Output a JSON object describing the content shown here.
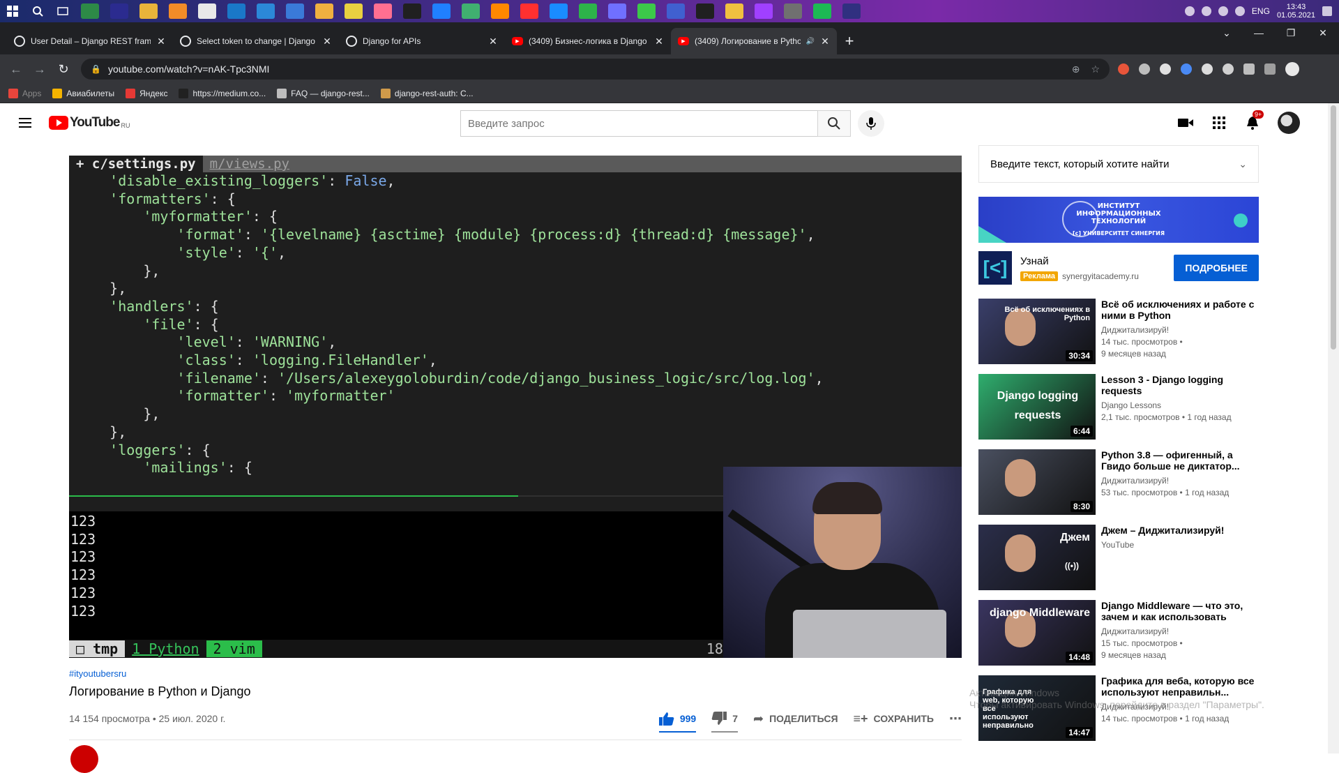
{
  "taskbar": {
    "lang": "ENG",
    "time": "13:43",
    "date": "01.05.2021",
    "apps": [
      "#2d8a47",
      "#2b2b8f",
      "#e8b43a",
      "#f28c28",
      "#e8e8e8",
      "#1a78c8",
      "#2b88d8",
      "#3a7ad8",
      "#f0b040",
      "#e8d040",
      "#ff6f91",
      "#202020",
      "#2080ff",
      "#40b070",
      "#ff8800",
      "#ff3030",
      "#1a8cff",
      "#2db34a",
      "#7070ff",
      "#3cc84a",
      "#4060d0",
      "#202020",
      "#f0c040",
      "#a040ff",
      "#707070",
      "#1db954",
      "#303080"
    ]
  },
  "browser": {
    "tabs": [
      {
        "title": "User Detail – Django REST framew",
        "icon": "chrome"
      },
      {
        "title": "Select token to change | Django s",
        "icon": "chrome"
      },
      {
        "title": "Django for APIs",
        "icon": "chrome"
      },
      {
        "title": "(3409) Бизнес-логика в Django и",
        "icon": "yt"
      },
      {
        "title": "(3409) Логирование в Python",
        "icon": "yt",
        "active": true
      }
    ],
    "url": "youtube.com/watch?v=nAK-Tpc3NMI",
    "bookmarks": [
      "Apps",
      "Авиабилеты",
      "Яндекс",
      "https://medium.co...",
      "FAQ — django-rest...",
      "django-rest-auth: C..."
    ]
  },
  "youtube": {
    "logo_text": "YouTube",
    "region": "RU",
    "search_placeholder": "Введите запрос",
    "notif_count": "9+"
  },
  "player": {
    "vim_tab_active": "+ c/settings.py",
    "vim_tab_other": "m/views.py",
    "code_lines": [
      [
        [
          "s",
          "    'disable_existing_loggers'"
        ],
        [
          "p",
          ": "
        ],
        [
          "k",
          "False"
        ],
        [
          "p",
          ","
        ]
      ],
      [
        [
          "s",
          "    'formatters'"
        ],
        [
          "p",
          ": {"
        ]
      ],
      [
        [
          "s",
          "        'myformatter'"
        ],
        [
          "p",
          ": {"
        ]
      ],
      [
        [
          "s",
          "            'format'"
        ],
        [
          "p",
          ": "
        ],
        [
          "s",
          "'{levelname} {asctime} {module} {process:d} {thread:d} {message}'"
        ],
        [
          "p",
          ","
        ]
      ],
      [
        [
          "s",
          "            'style'"
        ],
        [
          "p",
          ": "
        ],
        [
          "s",
          "'{'"
        ],
        [
          "p",
          ","
        ]
      ],
      [
        [
          "p",
          "        },"
        ]
      ],
      [
        [
          "p",
          "    },"
        ]
      ],
      [
        [
          "s",
          "    'handlers'"
        ],
        [
          "p",
          ": {"
        ]
      ],
      [
        [
          "s",
          "        'file'"
        ],
        [
          "p",
          ": {"
        ]
      ],
      [
        [
          "s",
          "            'level'"
        ],
        [
          "p",
          ": "
        ],
        [
          "s",
          "'WARNING'"
        ],
        [
          "p",
          ","
        ]
      ],
      [
        [
          "s",
          "            'class'"
        ],
        [
          "p",
          ": "
        ],
        [
          "s",
          "'logging.FileHandler'"
        ],
        [
          "p",
          ","
        ]
      ],
      [
        [
          "s",
          "            'filename'"
        ],
        [
          "p",
          ": "
        ],
        [
          "s",
          "'/Users/alexeygoloburdin/code/django_business_logic/src/log.log'"
        ],
        [
          "p",
          ","
        ]
      ],
      [
        [
          "s",
          "            'formatter'"
        ],
        [
          "p",
          ": "
        ],
        [
          "s",
          "'myformatter'"
        ]
      ],
      [
        [
          "p",
          "        },"
        ]
      ],
      [
        [
          "p",
          "    },"
        ]
      ],
      [
        [
          "s",
          "    'loggers'"
        ],
        [
          "p",
          ": {"
        ]
      ],
      [
        [
          "s",
          "        'mailings'"
        ],
        [
          "p",
          ": {"
        ]
      ]
    ],
    "terminal_lines": [
      "123",
      "123",
      "123",
      "123",
      "123",
      "123"
    ],
    "tmux_session": "□ tmp",
    "tmux_win1": "1 Python",
    "tmux_win2": "2 vim",
    "tmux_num": "18:"
  },
  "video": {
    "hashtag": "#ityoutubersru",
    "title": "Логирование в Python и Django",
    "views_date": "14 154 просмотра • 25 июл. 2020 г.",
    "likes": "999",
    "dislikes": "7",
    "share_label": "ПОДЕЛИТЬСЯ",
    "save_label": "СОХРАНИТЬ"
  },
  "sidebar": {
    "chat_placeholder": "Введите текст, который хотите найти",
    "ad": {
      "banner_text": "ИНСТИТУТ ИНФОРМАЦИОННЫХ ТЕХНОЛОГИЙ",
      "banner_sub": "[с] УНИВЕРСИТЕТ СИНЕРГИЯ",
      "title": "Узнай",
      "badge": "Реклама",
      "domain": "synergyitacademy.ru",
      "button": "ПОДРОБНЕЕ"
    },
    "recommendations": [
      {
        "title": "Всё об исключениях и работе с ними в Python",
        "channel": "Диджитализируй!",
        "views": "14 тыс. просмотров •",
        "age": "9 месяцев назад",
        "duration": "30:34",
        "overlay": "Всё об исключениях в Python",
        "bg": "#3a3f6a"
      },
      {
        "title": "Lesson 3 - Django logging requests",
        "channel": "Django Lessons",
        "views": "2,1 тыс. просмотров • 1 год назад",
        "age": "",
        "duration": "6:44",
        "overlay": "",
        "bg": "#2fae6e"
      },
      {
        "title": "Python 3.8 — офигенный, а Гвидо больше не диктатор...",
        "channel": "Диджитализируй!",
        "views": "53 тыс. просмотров • 1 год назад",
        "age": "",
        "duration": "8:30",
        "overlay": "",
        "bg": "#4a5060"
      },
      {
        "title": "Джем – Диджитализируй!",
        "channel": "YouTube",
        "views": "",
        "age": "",
        "duration": "",
        "overlay": "Джем",
        "bg": "#2b2e4a"
      },
      {
        "title": "Django Middleware — что это, зачем и как использовать",
        "channel": "Диджитализируй!",
        "views": "15 тыс. просмотров •",
        "age": "9 месяцев назад",
        "duration": "14:48",
        "overlay": "django Middleware",
        "bg": "#3a3560"
      },
      {
        "title": "Графика для веба, которую все используют неправильн...",
        "channel": "Диджитализируй!",
        "views": "14 тыс. просмотров • 1 год назад",
        "age": "",
        "duration": "14:47",
        "overlay": "",
        "bg": "#1f2a38"
      }
    ],
    "thumb2_text": "Django logging requests",
    "thumb6_text": "Графика для web, которую все используют неправильно"
  },
  "watermark": {
    "line1": "Активация Windows",
    "line2": "Чтобы активировать Windows, перейдите в раздел \"Параметры\"."
  }
}
